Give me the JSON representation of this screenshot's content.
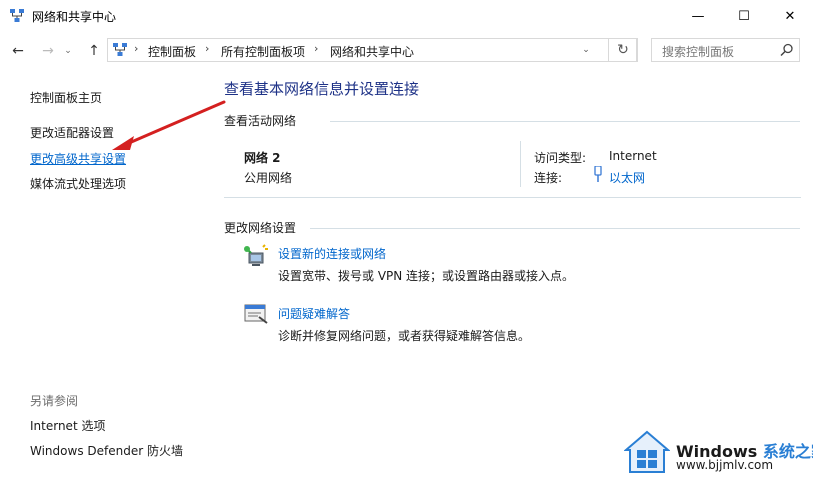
{
  "window": {
    "title": "网络和共享中心",
    "min_glyph": "—",
    "max_glyph": "☐",
    "close_glyph": "✕"
  },
  "nav": {
    "back_glyph": "←",
    "forward_glyph": "→",
    "recent_glyph": "⌄",
    "up_glyph": "↑",
    "refresh_glyph": "↻"
  },
  "address": {
    "crumbs": [
      "控制面板",
      "所有控制面板项",
      "网络和共享中心"
    ],
    "separator": "›",
    "dropdown_glyph": "⌄"
  },
  "search": {
    "placeholder": "搜索控制面板"
  },
  "sidebar": {
    "home": "控制面板主页",
    "items": [
      "更改适配器设置",
      "更改高级共享设置",
      "媒体流式处理选项"
    ],
    "see_also_title": "另请参阅",
    "see_also": [
      "Internet 选项",
      "Windows Defender 防火墙"
    ]
  },
  "main": {
    "title": "查看基本网络信息并设置连接",
    "active_networks_heading": "查看活动网络",
    "network": {
      "name": "网络 2",
      "type": "公用网络",
      "access_type_label": "访问类型:",
      "access_type_value": "Internet",
      "connection_label": "连接:",
      "connection_value": "以太网"
    },
    "change_heading": "更改网络设置",
    "tasks": [
      {
        "link": "设置新的连接或网络",
        "desc": "设置宽带、拨号或 VPN 连接；或设置路由器或接入点。"
      },
      {
        "link": "问题疑难解答",
        "desc": "诊断并修复网络问题，或者获得疑难解答信息。"
      }
    ]
  },
  "watermark": {
    "brand": "Windows",
    "brand_cn": "系统之家",
    "url": "www.bjjmlv.com"
  },
  "colors": {
    "link": "#0066cc",
    "title": "#1e3287",
    "arrow": "#d42020"
  }
}
